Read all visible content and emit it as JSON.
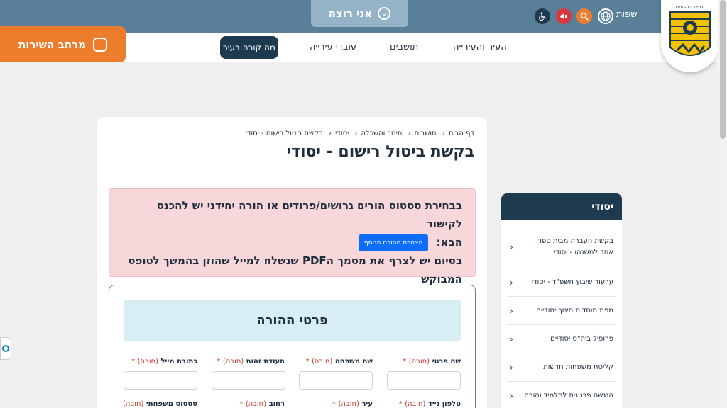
{
  "header": {
    "cta_label": "אני רוצה",
    "languages_label": "שפות",
    "service_label": "מרחב השירות",
    "logo_caption": "עיריית בית-שמש",
    "nav": [
      "העיר והעירייה",
      "תושבים",
      "עובדי עירייה"
    ],
    "nav_active": "מה קורה בעיר",
    "icons": [
      "globe-icon",
      "search-icon",
      "megaphone-icon",
      "accessibility-icon"
    ],
    "colors": {
      "topbar": "#5a7f99",
      "service": "#ec7d2c",
      "search": "#ec7d2c",
      "megaphone": "#d9363e",
      "accessibility": "#1e3a4f"
    }
  },
  "breadcrumb": [
    "דף הבית",
    "תושבים",
    "חינוך והשכלה",
    "יסודי",
    "בקשת ביטול רישום - יסודי"
  ],
  "page_title": "בקשת ביטול רישום - יסודי",
  "alert": {
    "line1": "בבחירת סטטוס הורים גרושים/פרודים או  הורה יחידני יש להכנס לקישור",
    "line2_prefix": "הבא:",
    "button_label": "הצהרת ההורה הנוסף",
    "line3": "בסיום יש לצרף את מסמך הPDF שנשלח למייל שהוזן בהמשך לטופס",
    "line4": "המבוקש"
  },
  "form": {
    "section_title": "פרטי ההורה",
    "required_mark": "(חובה)",
    "star": "*",
    "row1": [
      "שם פרטי",
      "שם משפחה",
      "תעודת זהות",
      "כתובת מייל"
    ],
    "row2": [
      "טלפון נייד",
      "עיר",
      "רחוב",
      "סטטוס משפחתי"
    ]
  },
  "sidebar": {
    "title": "יסודי",
    "items": [
      "בקשת העברה מבית ספר אחד למשנהו - יסודי",
      "ערעור שיבוץ תשפ\"ד - יסודי",
      "מפת מוסדות חינוך יסודיים",
      "פרופיל ביה\"ס יסודיים",
      "קליטת משפחות חדשות",
      "הנגשה פרטנית לתלמיד והורה"
    ]
  }
}
